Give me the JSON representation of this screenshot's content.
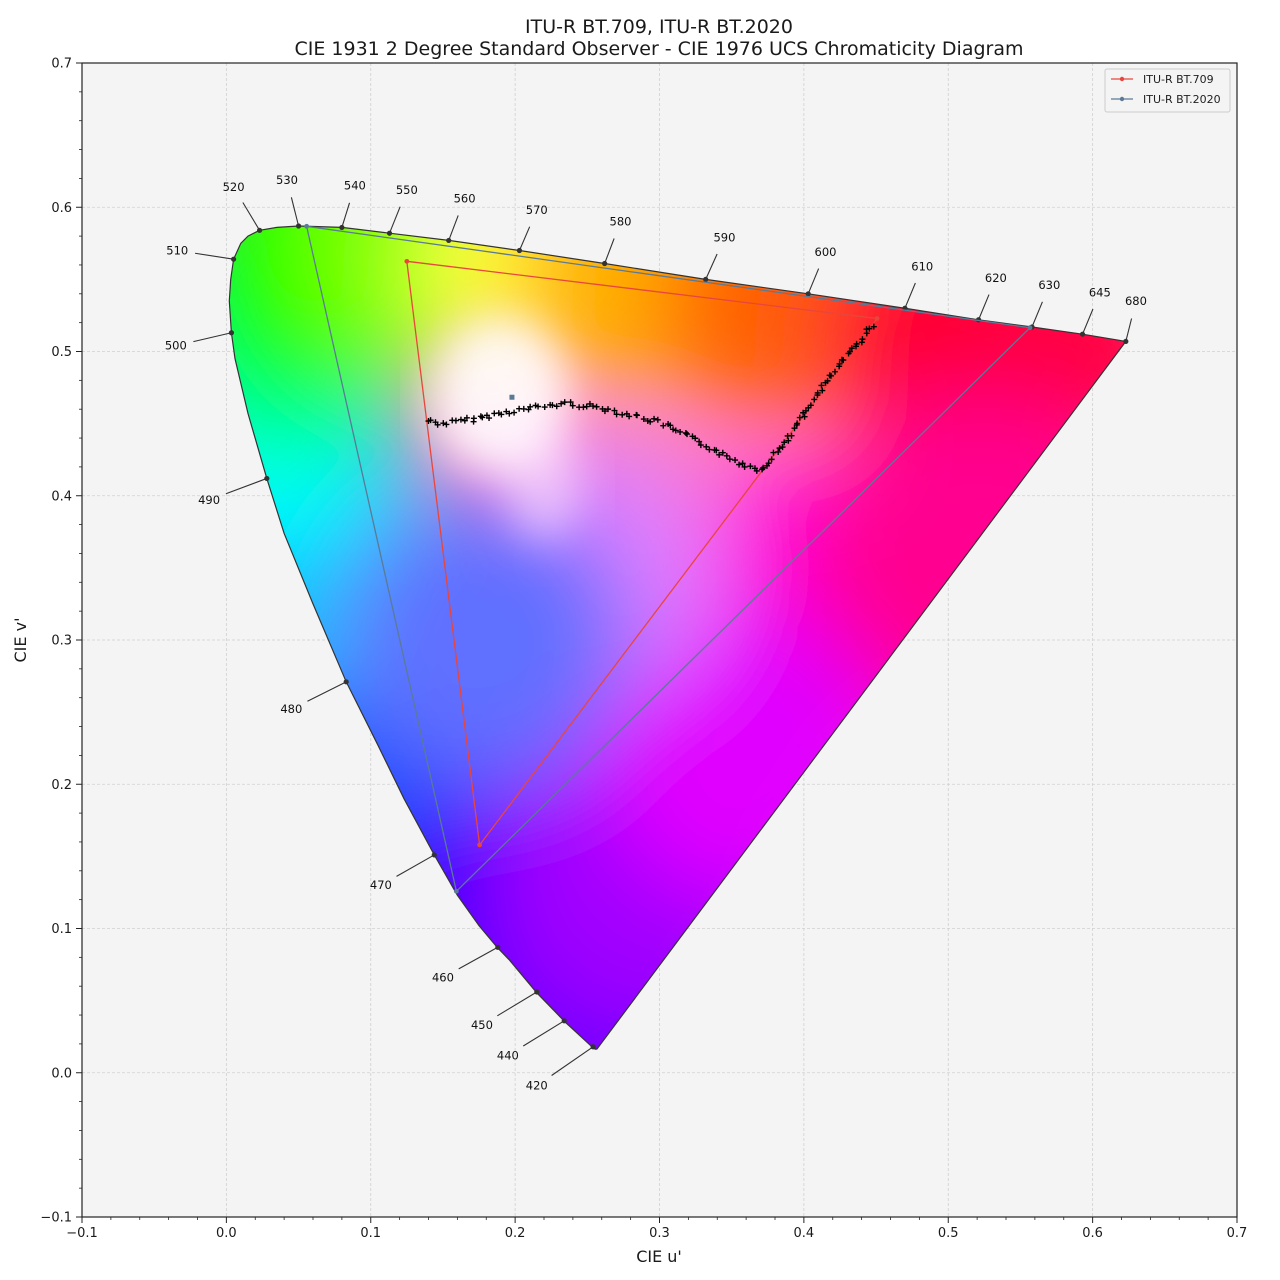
{
  "chart_data": {
    "type": "scatter",
    "title": "ITU-R BT.709, ITU-R BT.2020",
    "subtitle": "CIE 1931 2 Degree Standard Observer - CIE 1976 UCS Chromaticity Diagram",
    "xlabel": "CIE u'",
    "ylabel": "CIE v'",
    "xlim": [
      -0.1,
      0.7
    ],
    "ylim": [
      -0.1,
      0.7
    ],
    "x_ticks": [
      -0.1,
      0.0,
      0.1,
      0.2,
      0.3,
      0.4,
      0.5,
      0.6,
      0.7
    ],
    "y_ticks": [
      -0.1,
      0.0,
      0.1,
      0.2,
      0.3,
      0.4,
      0.5,
      0.6,
      0.7
    ],
    "x_tick_labels": [
      "−0.1",
      "0.0",
      "0.1",
      "0.2",
      "0.3",
      "0.4",
      "0.5",
      "0.6",
      "0.7"
    ],
    "y_tick_labels": [
      "−0.1",
      "0.0",
      "0.1",
      "0.2",
      "0.3",
      "0.4",
      "0.5",
      "0.6",
      "0.7"
    ],
    "grid": true,
    "legend_position": "top-right",
    "colors": {
      "background": "#f4f4f4",
      "bt709": "#e8463c",
      "bt2020": "#5a7a96",
      "locus_edge": "#333333",
      "marker": "#000000",
      "whitepoint": "#5a7a96"
    },
    "spectral_locus": [
      [
        0.2568,
        0.0165
      ],
      [
        0.2559,
        0.0163
      ],
      [
        0.2547,
        0.0167
      ],
      [
        0.2348,
        0.035
      ],
      [
        0.215,
        0.0554
      ],
      [
        0.1962,
        0.078
      ],
      [
        0.1876,
        0.0869
      ],
      [
        0.175,
        0.102
      ],
      [
        0.16,
        0.123
      ],
      [
        0.144,
        0.151
      ],
      [
        0.123,
        0.19
      ],
      [
        0.105,
        0.227
      ],
      [
        0.083,
        0.271
      ],
      [
        0.06,
        0.325
      ],
      [
        0.04,
        0.374
      ],
      [
        0.028,
        0.412
      ],
      [
        0.015,
        0.457
      ],
      [
        0.006,
        0.495
      ],
      [
        0.0035,
        0.513
      ],
      [
        0.002,
        0.535
      ],
      [
        0.003,
        0.55
      ],
      [
        0.005,
        0.564
      ],
      [
        0.01,
        0.575
      ],
      [
        0.015,
        0.58
      ],
      [
        0.023,
        0.584
      ],
      [
        0.035,
        0.586
      ],
      [
        0.05,
        0.587
      ],
      [
        0.08,
        0.586
      ],
      [
        0.113,
        0.582
      ],
      [
        0.154,
        0.577
      ],
      [
        0.203,
        0.57
      ],
      [
        0.262,
        0.561
      ],
      [
        0.332,
        0.55
      ],
      [
        0.403,
        0.54
      ],
      [
        0.47,
        0.53
      ],
      [
        0.521,
        0.522
      ],
      [
        0.558,
        0.517
      ],
      [
        0.593,
        0.512
      ],
      [
        0.623,
        0.507
      ]
    ],
    "wavelength_labels": [
      {
        "label": "420",
        "point": [
          0.254,
          0.018
        ],
        "text": [
          0.215,
          -0.009
        ]
      },
      {
        "label": "440",
        "point": [
          0.234,
          0.036
        ],
        "text": [
          0.195,
          0.012
        ]
      },
      {
        "label": "450",
        "point": [
          0.215,
          0.056
        ],
        "text": [
          0.177,
          0.033
        ]
      },
      {
        "label": "460",
        "point": [
          0.188,
          0.087
        ],
        "text": [
          0.15,
          0.066
        ]
      },
      {
        "label": "470",
        "point": [
          0.144,
          0.151
        ],
        "text": [
          0.107,
          0.13
        ]
      },
      {
        "label": "480",
        "point": [
          0.083,
          0.271
        ],
        "text": [
          0.045,
          0.252
        ]
      },
      {
        "label": "490",
        "point": [
          0.028,
          0.412
        ],
        "text": [
          -0.012,
          0.397
        ]
      },
      {
        "label": "500",
        "point": [
          0.0035,
          0.513
        ],
        "text": [
          -0.035,
          0.504
        ]
      },
      {
        "label": "510",
        "point": [
          0.005,
          0.564
        ],
        "text": [
          -0.034,
          0.57
        ]
      },
      {
        "label": "520",
        "point": [
          0.023,
          0.584
        ],
        "text": [
          0.005,
          0.614
        ]
      },
      {
        "label": "530",
        "point": [
          0.05,
          0.587
        ],
        "text": [
          0.042,
          0.619
        ]
      },
      {
        "label": "540",
        "point": [
          0.08,
          0.586
        ],
        "text": [
          0.089,
          0.615
        ]
      },
      {
        "label": "550",
        "point": [
          0.113,
          0.582
        ],
        "text": [
          0.125,
          0.612
        ]
      },
      {
        "label": "560",
        "point": [
          0.154,
          0.577
        ],
        "text": [
          0.165,
          0.606
        ]
      },
      {
        "label": "570",
        "point": [
          0.203,
          0.57
        ],
        "text": [
          0.215,
          0.598
        ]
      },
      {
        "label": "580",
        "point": [
          0.262,
          0.561
        ],
        "text": [
          0.273,
          0.59
        ]
      },
      {
        "label": "590",
        "point": [
          0.332,
          0.55
        ],
        "text": [
          0.345,
          0.579
        ]
      },
      {
        "label": "600",
        "point": [
          0.403,
          0.54
        ],
        "text": [
          0.415,
          0.569
        ]
      },
      {
        "label": "610",
        "point": [
          0.47,
          0.53
        ],
        "text": [
          0.482,
          0.559
        ]
      },
      {
        "label": "620",
        "point": [
          0.521,
          0.522
        ],
        "text": [
          0.533,
          0.551
        ]
      },
      {
        "label": "630",
        "point": [
          0.558,
          0.517
        ],
        "text": [
          0.57,
          0.546
        ]
      },
      {
        "label": "645",
        "point": [
          0.593,
          0.512
        ],
        "text": [
          0.605,
          0.541
        ]
      },
      {
        "label": "680",
        "point": [
          0.623,
          0.507
        ],
        "text": [
          0.63,
          0.535
        ]
      }
    ],
    "series": [
      {
        "name": "ITU-R BT.709",
        "points": [
          [
            0.4507,
            0.5229
          ],
          [
            0.125,
            0.5625
          ],
          [
            0.1754,
            0.1579
          ]
        ]
      },
      {
        "name": "ITU-R BT.2020",
        "points": [
          [
            0.5566,
            0.5165
          ],
          [
            0.0556,
            0.5868
          ],
          [
            0.1593,
            0.1258
          ]
        ]
      }
    ],
    "whitepoint": [
      0.1978,
      0.4683
    ],
    "samples_curve": [
      [
        0.14,
        0.452
      ],
      [
        0.15,
        0.45
      ],
      [
        0.165,
        0.452
      ],
      [
        0.18,
        0.455
      ],
      [
        0.2,
        0.459
      ],
      [
        0.22,
        0.462
      ],
      [
        0.235,
        0.464
      ],
      [
        0.26,
        0.461
      ],
      [
        0.28,
        0.456
      ],
      [
        0.3,
        0.451
      ],
      [
        0.32,
        0.441
      ],
      [
        0.34,
        0.431
      ],
      [
        0.355,
        0.423
      ],
      [
        0.37,
        0.418
      ],
      [
        0.39,
        0.441
      ],
      [
        0.41,
        0.471
      ],
      [
        0.43,
        0.497
      ],
      [
        0.45,
        0.521
      ]
    ]
  },
  "legend": {
    "items": [
      {
        "label": "ITU-R BT.709",
        "color": "#e8463c"
      },
      {
        "label": "ITU-R BT.2020",
        "color": "#5a7a96"
      }
    ]
  }
}
